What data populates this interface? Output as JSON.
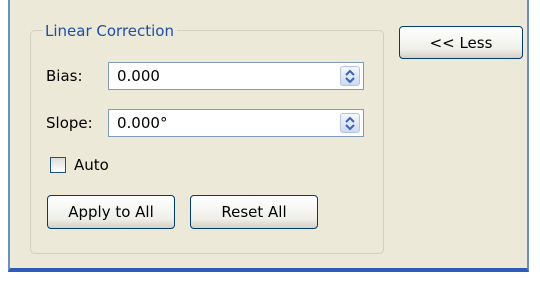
{
  "group": {
    "title": "Linear Correction"
  },
  "bias": {
    "label": "Bias:",
    "value": "0.000"
  },
  "slope": {
    "label": "Slope:",
    "value": "0.000°"
  },
  "auto": {
    "label": "Auto",
    "checked": false
  },
  "buttons": {
    "apply_all": "Apply to All",
    "reset_all": "Reset All",
    "less": "<< Less"
  },
  "icons": {
    "spinner": "up-down-arrows-icon"
  }
}
